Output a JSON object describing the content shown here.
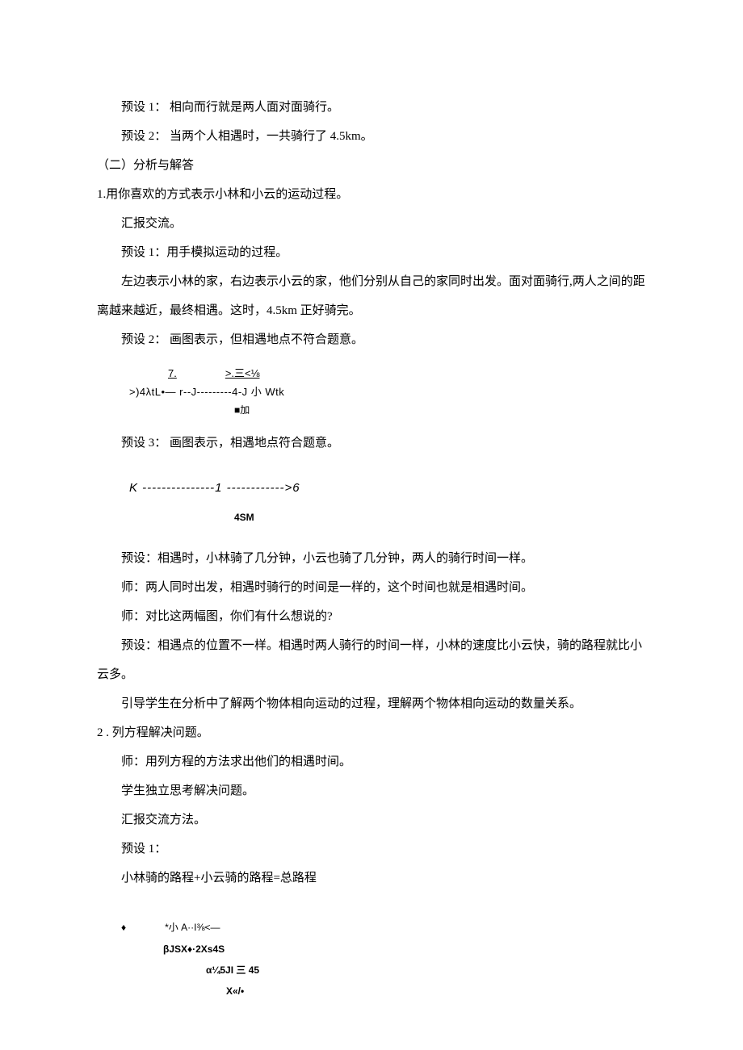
{
  "p1": "预设 1： 相向而行就是两人面对面骑行。",
  "p2": "预设 2： 当两个人相遇时，一共骑行了 4.5km。",
  "h1": "（二）分析与解答",
  "h2": "1.用你喜欢的方式表示小林和小云的运动过程。",
  "p3": "汇报交流。",
  "p4": "预设 1：用手模拟运动的过程。",
  "p5": "左边表示小林的家，右边表示小云的家，他们分别从自己的家同时出发。面对面骑行,两人之间的距离越来越近，最终相遇。这时，4.5km 正好骑完。",
  "p6": "预设 2： 画图表示，但相遇地点不符合题意。",
  "fig1": {
    "l1a": "7.",
    "l1b": ">.三<⅛",
    "l2": ">)4λtL•— r--J---------4-J 小 Wtk",
    "l3": "■加"
  },
  "p7": "预设 3： 画图表示，相遇地点符合题意。",
  "fig2": {
    "l1": "K ---------------1 ------------>6",
    "l2": "4SM"
  },
  "p8": "预设：相遇时，小林骑了几分钟，小云也骑了几分钟，两人的骑行时间一样。",
  "p9": "师：两人同时出发，相遇时骑行的时间是一样的，这个时间也就是相遇时间。",
  "p10": "师：对比这两幅图，你们有什么想说的?",
  "p11": "预设：相遇点的位置不一样。相遇时两人骑行的时间一样，小林的速度比小云快，骑的路程就比小云多。",
  "p12": "引导学生在分析中了解两个物体相向运动的过程，理解两个物体相向运动的数量关系。",
  "h3": "2  . 列方程解决问题。",
  "p13": "师：用列方程的方法求出他们的相遇时间。",
  "p14": "学生独立思考解决问题。",
  "p15": "汇报交流方法。",
  "p16": "预设 1：",
  "p17": "小林骑的路程+小云骑的路程=总路程",
  "math": {
    "l1": "♦　　　　*小 A··I⅜<—",
    "l2": "βJSX♦·2Xs4S",
    "l3": "α¼5JI 三 45",
    "l4": "X«/•"
  }
}
